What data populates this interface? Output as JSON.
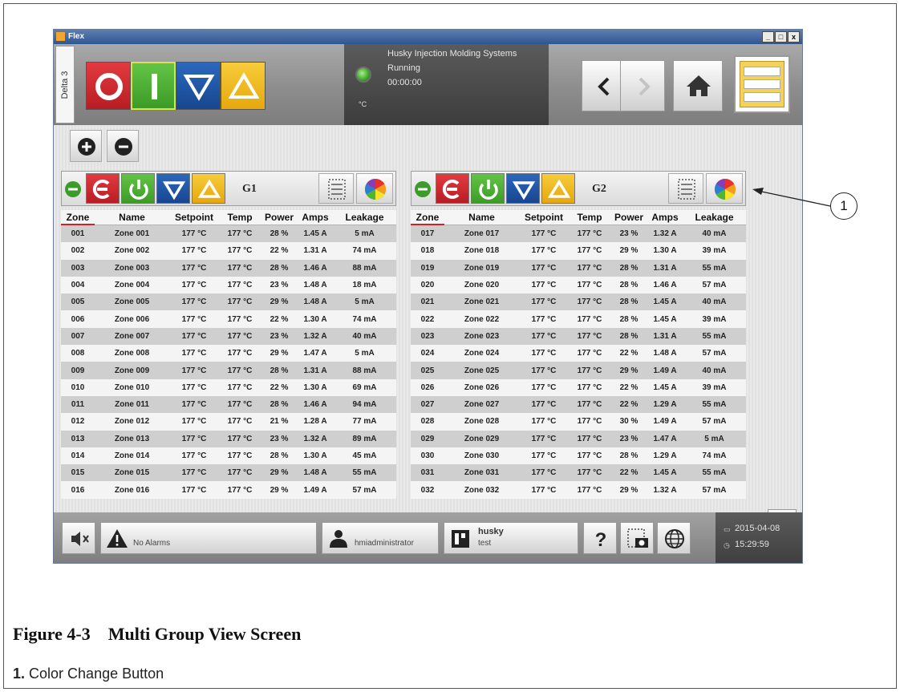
{
  "window": {
    "title": "Flex",
    "controls": [
      "_",
      "□",
      "x"
    ]
  },
  "header": {
    "delta_tab": "Delta 3",
    "status_unit": "°C",
    "status_lines": [
      "Husky Injection Molding Systems",
      "Running",
      "00:00:00"
    ]
  },
  "groups": [
    {
      "name": "G1",
      "columns": [
        "Zone",
        "Name",
        "Setpoint",
        "Temp",
        "Power",
        "Amps",
        "Leakage"
      ],
      "rows": [
        [
          "001",
          "Zone 001",
          "177 °C",
          "177 °C",
          "28 %",
          "1.45 A",
          "5 mA"
        ],
        [
          "002",
          "Zone 002",
          "177 °C",
          "177 °C",
          "22 %",
          "1.31 A",
          "74 mA"
        ],
        [
          "003",
          "Zone 003",
          "177 °C",
          "177 °C",
          "28 %",
          "1.46 A",
          "88 mA"
        ],
        [
          "004",
          "Zone 004",
          "177 °C",
          "177 °C",
          "23 %",
          "1.48 A",
          "18 mA"
        ],
        [
          "005",
          "Zone 005",
          "177 °C",
          "177 °C",
          "29 %",
          "1.48 A",
          "5 mA"
        ],
        [
          "006",
          "Zone 006",
          "177 °C",
          "177 °C",
          "22 %",
          "1.30 A",
          "74 mA"
        ],
        [
          "007",
          "Zone 007",
          "177 °C",
          "177 °C",
          "23 %",
          "1.32 A",
          "40 mA"
        ],
        [
          "008",
          "Zone 008",
          "177 °C",
          "177 °C",
          "29 %",
          "1.47 A",
          "5 mA"
        ],
        [
          "009",
          "Zone 009",
          "177 °C",
          "177 °C",
          "28 %",
          "1.31 A",
          "88 mA"
        ],
        [
          "010",
          "Zone 010",
          "177 °C",
          "177 °C",
          "22 %",
          "1.30 A",
          "69 mA"
        ],
        [
          "011",
          "Zone 011",
          "177 °C",
          "177 °C",
          "28 %",
          "1.46 A",
          "94 mA"
        ],
        [
          "012",
          "Zone 012",
          "177 °C",
          "177 °C",
          "21 %",
          "1.28 A",
          "77 mA"
        ],
        [
          "013",
          "Zone 013",
          "177 °C",
          "177 °C",
          "23 %",
          "1.32 A",
          "89 mA"
        ],
        [
          "014",
          "Zone 014",
          "177 °C",
          "177 °C",
          "28 %",
          "1.30 A",
          "45 mA"
        ],
        [
          "015",
          "Zone 015",
          "177 °C",
          "177 °C",
          "29 %",
          "1.48 A",
          "55 mA"
        ],
        [
          "016",
          "Zone 016",
          "177 °C",
          "177 °C",
          "29 %",
          "1.49 A",
          "57 mA"
        ]
      ]
    },
    {
      "name": "G2",
      "columns": [
        "Zone",
        "Name",
        "Setpoint",
        "Temp",
        "Power",
        "Amps",
        "Leakage"
      ],
      "rows": [
        [
          "017",
          "Zone 017",
          "177 °C",
          "177 °C",
          "23 %",
          "1.32 A",
          "40 mA"
        ],
        [
          "018",
          "Zone 018",
          "177 °C",
          "177 °C",
          "29 %",
          "1.30 A",
          "39 mA"
        ],
        [
          "019",
          "Zone 019",
          "177 °C",
          "177 °C",
          "28 %",
          "1.31 A",
          "55 mA"
        ],
        [
          "020",
          "Zone 020",
          "177 °C",
          "177 °C",
          "28 %",
          "1.46 A",
          "57 mA"
        ],
        [
          "021",
          "Zone 021",
          "177 °C",
          "177 °C",
          "28 %",
          "1.45 A",
          "40 mA"
        ],
        [
          "022",
          "Zone 022",
          "177 °C",
          "177 °C",
          "28 %",
          "1.45 A",
          "39 mA"
        ],
        [
          "023",
          "Zone 023",
          "177 °C",
          "177 °C",
          "28 %",
          "1.31 A",
          "55 mA"
        ],
        [
          "024",
          "Zone 024",
          "177 °C",
          "177 °C",
          "22 %",
          "1.48 A",
          "57 mA"
        ],
        [
          "025",
          "Zone 025",
          "177 °C",
          "177 °C",
          "29 %",
          "1.49 A",
          "40 mA"
        ],
        [
          "026",
          "Zone 026",
          "177 °C",
          "177 °C",
          "22 %",
          "1.45 A",
          "39 mA"
        ],
        [
          "027",
          "Zone 027",
          "177 °C",
          "177 °C",
          "22 %",
          "1.29 A",
          "55 mA"
        ],
        [
          "028",
          "Zone 028",
          "177 °C",
          "177 °C",
          "30 %",
          "1.49 A",
          "57 mA"
        ],
        [
          "029",
          "Zone 029",
          "177 °C",
          "177 °C",
          "23 %",
          "1.47 A",
          "5 mA"
        ],
        [
          "030",
          "Zone 030",
          "177 °C",
          "177 °C",
          "28 %",
          "1.29 A",
          "74 mA"
        ],
        [
          "031",
          "Zone 031",
          "177 °C",
          "177 °C",
          "22 %",
          "1.45 A",
          "55 mA"
        ],
        [
          "032",
          "Zone 032",
          "177 °C",
          "177 °C",
          "29 %",
          "1.32 A",
          "57 mA"
        ]
      ]
    }
  ],
  "footer": {
    "alarm_label": "No Alarms",
    "user_label": "hmiadministrator",
    "mold_name": "husky",
    "mold_sub": "test",
    "date": "2015-04-08",
    "time": "15:29:59"
  },
  "figure": {
    "callout_number": "1",
    "caption": "Figure 4-3    Multi Group View Screen",
    "legend_number": "1.",
    "legend_text": "Color Change Button"
  },
  "colors": {
    "stop_red": "#d4262e",
    "start_green": "#4fb534",
    "lower_blue": "#2258a8",
    "raise_yellow": "#f2bc1c",
    "title_blue": "#2f5592",
    "zone_header_underline": "#c8242b"
  }
}
